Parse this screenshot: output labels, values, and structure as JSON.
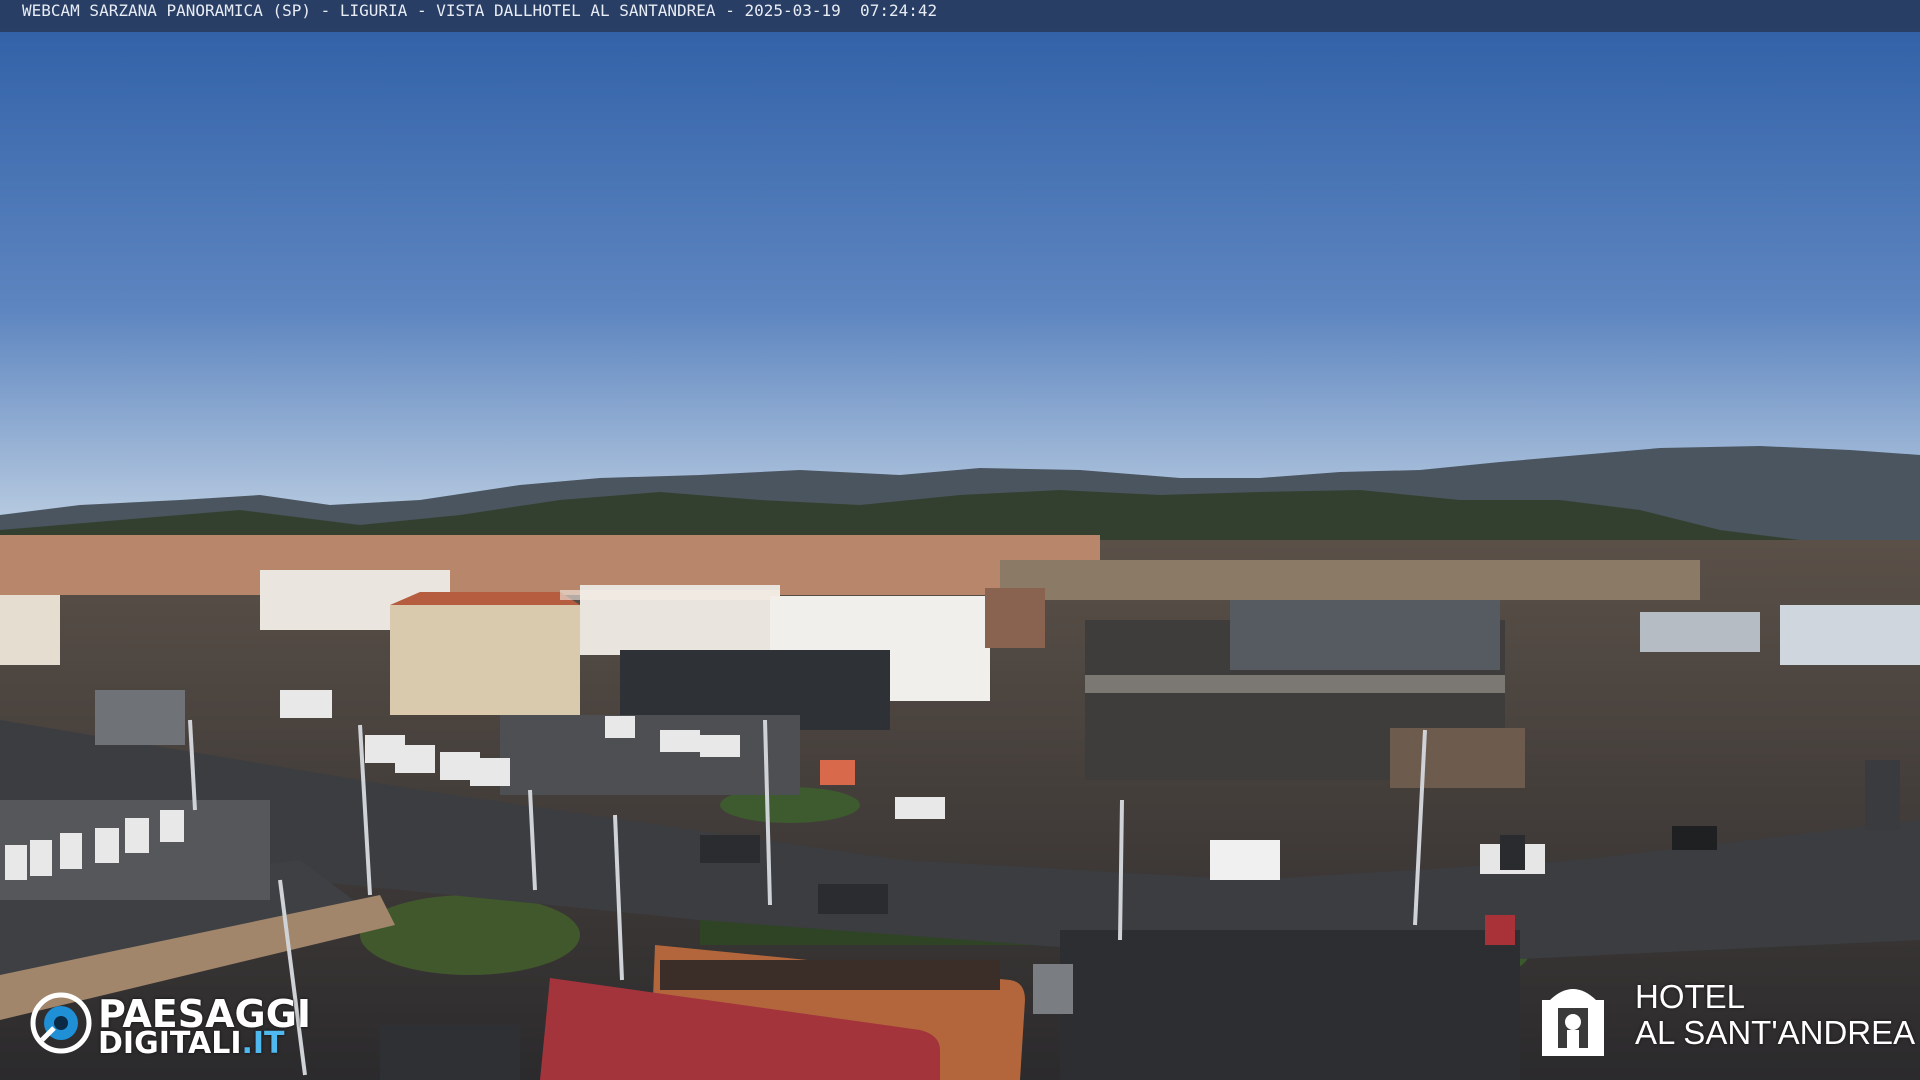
{
  "overlay": {
    "title": "WEBCAM SARZANA PANORAMICA (SP) - LIGURIA - VISTA DALLHOTEL AL SANTANDREA - 2025-03-19  07:24:42"
  },
  "logo_left": {
    "line1": "PAESAGGI",
    "line2_main": "DIGITALI",
    "line2_suffix": ".IT",
    "accent_color": "#4fb8ef"
  },
  "logo_right": {
    "line1": "HOTEL",
    "line2": "AL SANT'ANDREA"
  },
  "scene": {
    "sky_top": "#2f5fa5",
    "sky_bottom": "#a9c1dc",
    "hills": "#3b4148",
    "road": "#3a3c40"
  }
}
